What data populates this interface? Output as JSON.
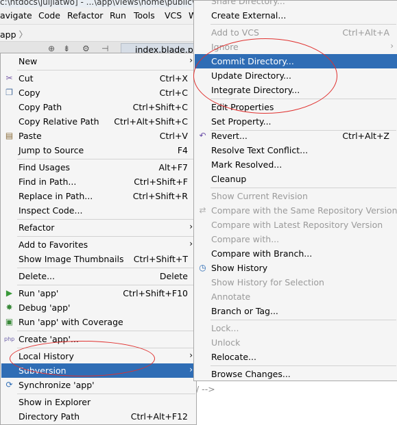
{
  "window": {
    "title": "c:\\htdocs\\juijiatwo] - ...\\app\\views\\home\\public\\b"
  },
  "menubar": {
    "items": [
      "avigate",
      "Code",
      "Refactor",
      "Run",
      "Tools",
      "VCS",
      "W"
    ]
  },
  "breadcrumb": {
    "label": "app",
    "chevron": "〉"
  },
  "toolbar": {
    "file_tab": "index.blade.ph"
  },
  "editor": {
    "text": "/ -->"
  },
  "context_menu": {
    "items": [
      {
        "label": "New",
        "shortcut": "",
        "submenu": true
      },
      {
        "label": "Cut",
        "shortcut": "Ctrl+X",
        "icon": "scissors-icon"
      },
      {
        "label": "Copy",
        "shortcut": "Ctrl+C",
        "icon": "copy-icon"
      },
      {
        "label": "Copy Path",
        "shortcut": "Ctrl+Shift+C"
      },
      {
        "label": "Copy Relative Path",
        "shortcut": "Ctrl+Alt+Shift+C"
      },
      {
        "label": "Paste",
        "shortcut": "Ctrl+V",
        "icon": "paste-icon"
      },
      {
        "label": "Jump to Source",
        "shortcut": "F4"
      },
      {
        "label": "Find Usages",
        "shortcut": "Alt+F7"
      },
      {
        "label": "Find in Path...",
        "shortcut": "Ctrl+Shift+F"
      },
      {
        "label": "Replace in Path...",
        "shortcut": "Ctrl+Shift+R"
      },
      {
        "label": "Inspect Code...",
        "shortcut": ""
      },
      {
        "label": "Refactor",
        "shortcut": "",
        "submenu": true
      },
      {
        "label": "Add to Favorites",
        "shortcut": "",
        "submenu": true
      },
      {
        "label": "Show Image Thumbnails",
        "shortcut": "Ctrl+Shift+T"
      },
      {
        "label": "Delete...",
        "shortcut": "Delete"
      },
      {
        "label": "Run 'app'",
        "shortcut": "Ctrl+Shift+F10",
        "icon": "run-icon"
      },
      {
        "label": "Debug 'app'",
        "shortcut": "",
        "icon": "debug-icon"
      },
      {
        "label": "Run 'app' with Coverage",
        "shortcut": "",
        "icon": "coverage-icon"
      },
      {
        "label": "Create 'app'...",
        "shortcut": "",
        "icon": "php-icon"
      },
      {
        "label": "Local History",
        "shortcut": "",
        "submenu": true
      },
      {
        "label": "Subversion",
        "shortcut": "",
        "submenu": true,
        "selected": true
      },
      {
        "label": "Synchronize 'app'",
        "shortcut": "",
        "icon": "sync-icon"
      },
      {
        "label": "Show in Explorer",
        "shortcut": ""
      },
      {
        "label": "Directory Path",
        "shortcut": "Ctrl+Alt+F12"
      }
    ]
  },
  "submenu": {
    "items": [
      {
        "label": "Share Directory...",
        "shortcut": ""
      },
      {
        "label": "Create External...",
        "shortcut": ""
      },
      {
        "label": "Add to VCS",
        "shortcut": "Ctrl+Alt+A",
        "disabled": true
      },
      {
        "label": "Ignore",
        "shortcut": "",
        "disabled": true,
        "submenu": true
      },
      {
        "label": "Commit Directory...",
        "shortcut": "",
        "selected": true
      },
      {
        "label": "Update Directory...",
        "shortcut": ""
      },
      {
        "label": "Integrate Directory...",
        "shortcut": ""
      },
      {
        "label": "Edit Properties",
        "shortcut": ""
      },
      {
        "label": "Set Property...",
        "shortcut": ""
      },
      {
        "label": "Revert...",
        "shortcut": "Ctrl+Alt+Z",
        "icon": "revert-icon"
      },
      {
        "label": "Resolve Text Conflict...",
        "shortcut": ""
      },
      {
        "label": "Mark Resolved...",
        "shortcut": ""
      },
      {
        "label": "Cleanup",
        "shortcut": ""
      },
      {
        "label": "Show Current Revision",
        "shortcut": "",
        "disabled": true
      },
      {
        "label": "Compare with the Same Repository Version",
        "shortcut": "",
        "disabled": true,
        "icon": "compare-icon"
      },
      {
        "label": "Compare with Latest Repository Version",
        "shortcut": "",
        "disabled": true
      },
      {
        "label": "Compare with...",
        "shortcut": "",
        "disabled": true
      },
      {
        "label": "Compare with Branch...",
        "shortcut": ""
      },
      {
        "label": "Show History",
        "shortcut": "",
        "icon": "history-icon"
      },
      {
        "label": "Show History for Selection",
        "shortcut": "",
        "disabled": true
      },
      {
        "label": "Annotate",
        "shortcut": "",
        "disabled": true
      },
      {
        "label": "Branch or Tag...",
        "shortcut": ""
      },
      {
        "label": "Lock...",
        "shortcut": "",
        "disabled": true
      },
      {
        "label": "Unlock",
        "shortcut": "",
        "disabled": true
      },
      {
        "label": "Relocate...",
        "shortcut": ""
      },
      {
        "label": "Browse Changes...",
        "shortcut": ""
      }
    ]
  },
  "colors": {
    "selection": "#2f6db5",
    "annotation": "#e0302e",
    "menu_bg": "#f5f5f5"
  }
}
